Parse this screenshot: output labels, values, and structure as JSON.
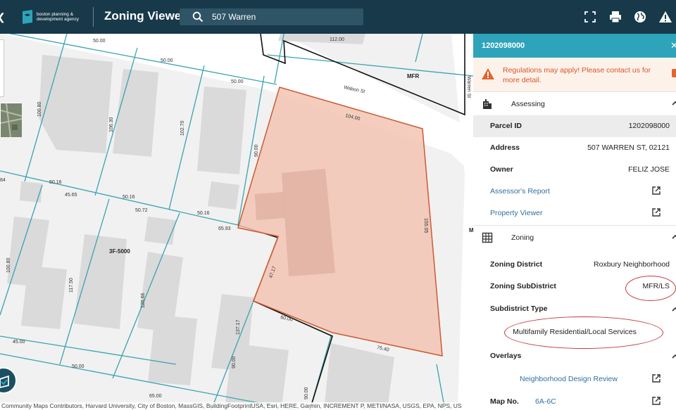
{
  "header": {
    "back_glyph": "❮",
    "logo_text": "boston planning & development agency",
    "app_title": "Zoning Viewer",
    "search_value": "507 Warren",
    "icons": [
      "fullscreen-icon",
      "print-icon",
      "globe-icon",
      "warning-icon"
    ]
  },
  "map": {
    "attribution": "Community Maps Contributors, Harvard University, City of Boston, MassGIS, BuildingFootprintUSA, Esri, HERE, Garmin, INCREMENT P, METI/NASA, USGS, EPA, NPS, US",
    "zone_labels": {
      "mfr": "MFR",
      "threef": "3F-5000"
    },
    "street_labels": {
      "wabon": "Wabon St",
      "warren": "Warren St",
      "m": "M"
    },
    "dims": {
      "d1": "50.00",
      "d2": "50.00",
      "d3": "50.00",
      "d4": "112.00",
      "d5": "104.00",
      "d6": "100.80",
      "d7": "106.30",
      "d8": "102.70",
      "d9": "90.00",
      "d10": "155.05",
      "d11": "50.16",
      "d12": "50.16",
      "d13": "45.65",
      "d14": "50.72",
      "d15": "50.16",
      "d16": "65.93",
      "d17": "84",
      "d18": "100.80",
      "d19": "117.50",
      "d20": "126.66",
      "d21": "47.17",
      "d22": "137.17",
      "d23": "60.00",
      "d24": "75.40",
      "d25": "45.00",
      "d26": "50.00",
      "d27": "65.00",
      "d28": "90.00",
      "d29": "90.00"
    }
  },
  "panel": {
    "parcel_title": "1202098000",
    "close_glyph": "✕",
    "alert": "Regulations may apply! Please contact us for more detail.",
    "assessing": {
      "label": "Assessing",
      "parcel_id_label": "Parcel ID",
      "parcel_id": "1202098000",
      "address_label": "Address",
      "address": "507 WARREN ST, 02121",
      "owner_label": "Owner",
      "owner": "FELIZ JOSE",
      "assessor_link": "Assessor's Report",
      "property_link": "Property Viewer"
    },
    "zoning": {
      "label": "Zoning",
      "district_label": "Zoning District",
      "district": "Roxbury Neighborhood",
      "subdistrict_label": "Zoning SubDistrict",
      "subdistrict": "MFR/LS",
      "type_label": "Subdistrict Type",
      "type": "Multifamily Residential/Local Services",
      "overlays_label": "Overlays",
      "overlay_link": "Neighborhood Design Review",
      "mapno_label": "Map No.",
      "mapno": "6A-6C"
    }
  },
  "colors": {
    "header_bg": "#17394a",
    "panel_head": "#2ea4ba",
    "alert_text": "#d9552b",
    "parcel_fill": "#f2c4b3",
    "parcel_stroke": "#cc5a34",
    "lot_lines": "#3aa3b0",
    "link": "#2f6f9e",
    "highlight": "#c0393a"
  }
}
